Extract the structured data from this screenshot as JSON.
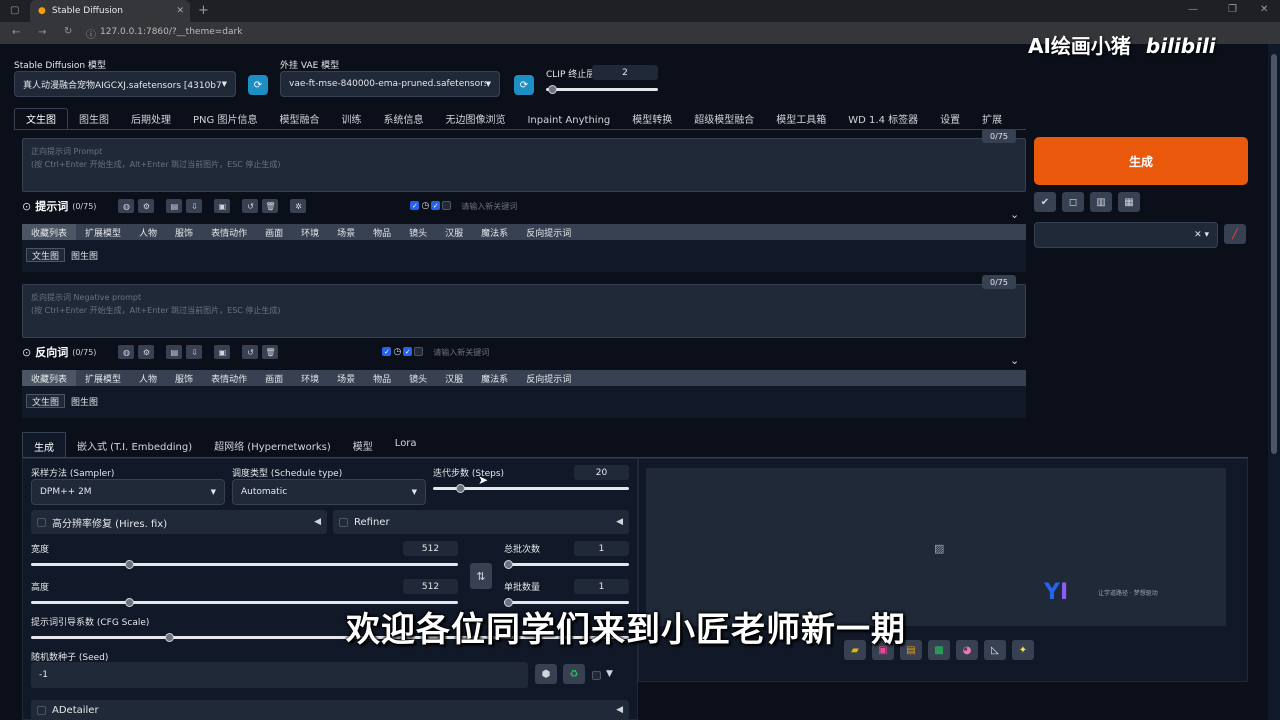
{
  "browser": {
    "tab_title": "Stable Diffusion",
    "url": "127.0.0.1:7860/?__theme=dark"
  },
  "header": {
    "model_label": "Stable Diffusion 模型",
    "model_value": "真人动漫融合宠物AIGCXJ.safetensors [4310b7l",
    "vae_label": "外挂 VAE 模型",
    "vae_value": "vae-ft-mse-840000-ema-pruned.safetensors",
    "clip_label": "CLIP 终止层数",
    "clip_value": "2",
    "clip_fraction": 0.05
  },
  "main_tabs": [
    "文生图",
    "图生图",
    "后期处理",
    "PNG 图片信息",
    "模型融合",
    "训练",
    "系统信息",
    "无边图像浏览",
    "Inpaint Anything",
    "模型转换",
    "超级模型融合",
    "模型工具箱",
    "WD 1.4 标签器",
    "设置",
    "扩展"
  ],
  "prompt": {
    "counter": "0/75",
    "placeholder_1": "正向提示词 Prompt",
    "placeholder_2": "(按 Ctrl+Enter 开始生成，Alt+Enter 跳过当前图片，ESC 停止生成)",
    "title": "提示词",
    "title_count": "(0/75)",
    "keyword_placeholder": "请输入新关键词"
  },
  "negative": {
    "counter": "0/75",
    "placeholder_1": "反向提示词 Negative prompt",
    "placeholder_2": "(按 Ctrl+Enter 开始生成，Alt+Enter 跳过当前图片，ESC 停止生成)",
    "title": "反向词",
    "title_count": "(0/75)",
    "keyword_placeholder": "请输入新关键词"
  },
  "categories": [
    "收藏列表",
    "扩展模型",
    "人物",
    "服饰",
    "表情动作",
    "画面",
    "环境",
    "场景",
    "物品",
    "镜头",
    "汉服",
    "魔法系",
    "反向提示词"
  ],
  "sub_tabs": [
    "文生图",
    "图生图"
  ],
  "generate_label": "生成",
  "gen_tabs": [
    "生成",
    "嵌入式 (T.I. Embedding)",
    "超网络 (Hypernetworks)",
    "模型",
    "Lora"
  ],
  "params": {
    "sampler_label": "采样方法 (Sampler)",
    "sampler_value": "DPM++ 2M",
    "schedule_label": "调度类型 (Schedule type)",
    "schedule_value": "Automatic",
    "steps_label": "迭代步数 (Steps)",
    "steps_value": "20",
    "steps_fraction": 0.14,
    "hires_label": "高分辨率修复 (Hires. fix)",
    "refiner_label": "Refiner",
    "width_label": "宽度",
    "width_value": "512",
    "width_fraction": 0.23,
    "height_label": "高度",
    "height_value": "512",
    "height_fraction": 0.23,
    "batch_count_label": "总批次数",
    "batch_count_value": "1",
    "batch_size_label": "单批数量",
    "batch_size_value": "1",
    "cfg_label": "提示词引导系数 (CFG Scale)",
    "cfg_fraction": 0.23,
    "seed_label": "随机数种子 (Seed)",
    "seed_value": "-1",
    "adetailer_label": "ADetailer"
  },
  "overlay": {
    "subtitle": "欢迎各位同学们来到小匠老师新一期",
    "watermark": "AI绘画小猪",
    "watermark_brand": "bilibili",
    "logo_text": "让学道路径 · 梦想驱动"
  },
  "colors": {
    "generate": "#ea580c",
    "accent_blue": "#1e8fc4",
    "background": "#0b0f19"
  }
}
